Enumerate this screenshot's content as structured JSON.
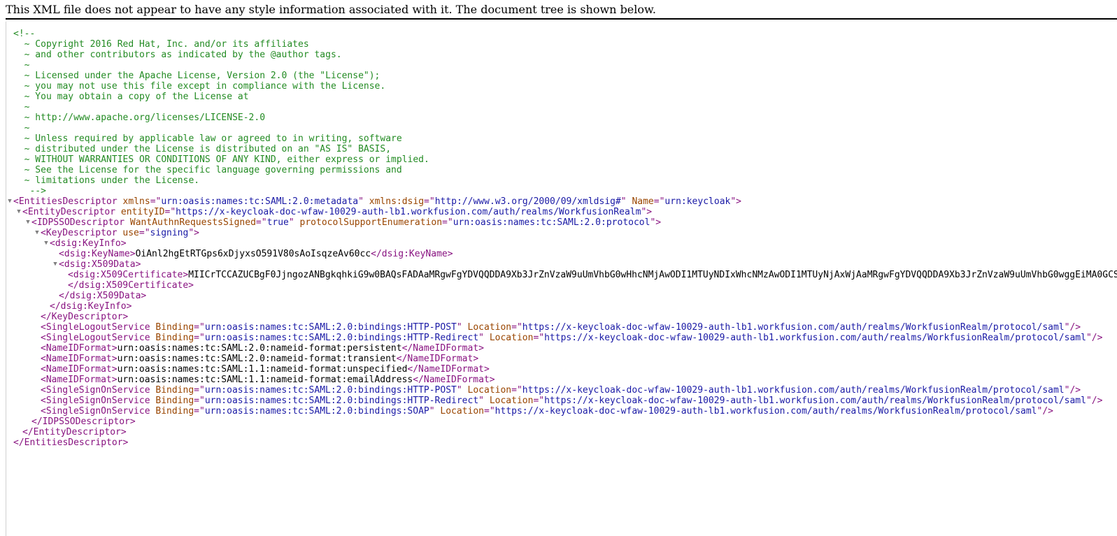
{
  "banner": {
    "text": "This XML file does not appear to have any style information associated with it. The document tree is shown below."
  },
  "colors": {
    "tag": "#881280",
    "attribute_name": "#994500",
    "attribute_value": "#1a1aa6",
    "comment": "#238b23",
    "text": "#000000"
  },
  "icons": {
    "expanded": "triangle-down-icon"
  },
  "comment_lines": [
    "<!--",
    "  ~ Copyright 2016 Red Hat, Inc. and/or its affiliates",
    "  ~ and other contributors as indicated by the @author tags.",
    "  ~",
    "  ~ Licensed under the Apache License, Version 2.0 (the \"License\");",
    "  ~ you may not use this file except in compliance with the License.",
    "  ~ You may obtain a copy of the License at",
    "  ~",
    "  ~ http://www.apache.org/licenses/LICENSE-2.0",
    "  ~",
    "  ~ Unless required by applicable law or agreed to in writing, software",
    "  ~ distributed under the License is distributed on an \"AS IS\" BASIS,",
    "  ~ WITHOUT WARRANTIES OR CONDITIONS OF ANY KIND, either express or implied.",
    "  ~ See the License for the specific language governing permissions and",
    "  ~ limitations under the License.",
    "   -->"
  ],
  "tree": [
    {
      "name": "entities-descriptor-open",
      "depth": 0,
      "fold": true,
      "parts": [
        [
          "t",
          "<EntitiesDescriptor"
        ],
        [
          "a",
          " xmlns"
        ],
        [
          "t",
          "=\""
        ],
        [
          "v",
          "urn:oasis:names:tc:SAML:2.0:metadata"
        ],
        [
          "t",
          "\""
        ],
        [
          "a",
          " xmlns:dsig"
        ],
        [
          "t",
          "=\""
        ],
        [
          "v",
          "http://www.w3.org/2000/09/xmldsig#"
        ],
        [
          "t",
          "\""
        ],
        [
          "a",
          " Name"
        ],
        [
          "t",
          "=\""
        ],
        [
          "v",
          "urn:keycloak"
        ],
        [
          "t",
          "\">"
        ]
      ]
    },
    {
      "name": "entity-descriptor-open",
      "depth": 1,
      "fold": true,
      "parts": [
        [
          "t",
          "<EntityDescriptor"
        ],
        [
          "a",
          " entityID"
        ],
        [
          "t",
          "=\""
        ],
        [
          "v",
          "https://x-keycloak-doc-wfaw-10029-auth-lb1.workfusion.com/auth/realms/WorkfusionRealm"
        ],
        [
          "t",
          "\">"
        ]
      ]
    },
    {
      "name": "idpsso-descriptor-open",
      "depth": 2,
      "fold": true,
      "parts": [
        [
          "t",
          "<IDPSSODescriptor"
        ],
        [
          "a",
          " WantAuthnRequestsSigned"
        ],
        [
          "t",
          "=\""
        ],
        [
          "v",
          "true"
        ],
        [
          "t",
          "\""
        ],
        [
          "a",
          " protocolSupportEnumeration"
        ],
        [
          "t",
          "=\""
        ],
        [
          "v",
          "urn:oasis:names:tc:SAML:2.0:protocol"
        ],
        [
          "t",
          "\">"
        ]
      ]
    },
    {
      "name": "key-descriptor-open",
      "depth": 3,
      "fold": true,
      "parts": [
        [
          "t",
          "<KeyDescriptor"
        ],
        [
          "a",
          " use"
        ],
        [
          "t",
          "=\""
        ],
        [
          "v",
          "signing"
        ],
        [
          "t",
          "\">"
        ]
      ]
    },
    {
      "name": "key-info-open",
      "depth": 4,
      "fold": true,
      "parts": [
        [
          "t",
          "<dsig:KeyInfo>"
        ]
      ]
    },
    {
      "name": "key-name",
      "depth": 5,
      "fold": false,
      "parts": [
        [
          "t",
          "<dsig:KeyName>"
        ],
        [
          "x",
          "OiAnl2hgEtRTGps6xDjyxsO591V80sAoIsqzeAv60cc"
        ],
        [
          "t",
          "</dsig:KeyName>"
        ]
      ]
    },
    {
      "name": "x509-data-open",
      "depth": 5,
      "fold": true,
      "parts": [
        [
          "t",
          "<dsig:X509Data>"
        ]
      ]
    },
    {
      "name": "x509-certificate",
      "depth": 6,
      "fold": false,
      "parts": [
        [
          "t",
          "<dsig:X509Certificate>"
        ],
        [
          "x",
          "MIICrTCCAZUCBgF0JjngozANBgkqhkiG9w0BAQsFADAaMRgwFgYDVQQDDA9Xb3JrZnVzaW9uUmVhbG0wHhcNMjAwODI1MTUyNDIxWhcNMzAwODI1MTUyNjAxWjAaMRgwFgYDVQQDDA9Xb3JrZnVzaW9uUmVhbG0wggEiMA0GCS"
        ]
      ]
    },
    {
      "name": "x509-certificate-close",
      "depth": 6,
      "fold": false,
      "parts": [
        [
          "t",
          "</dsig:X509Certificate>"
        ]
      ]
    },
    {
      "name": "x509-data-close",
      "depth": 5,
      "fold": false,
      "parts": [
        [
          "t",
          "</dsig:X509Data>"
        ]
      ]
    },
    {
      "name": "key-info-close",
      "depth": 4,
      "fold": false,
      "parts": [
        [
          "t",
          "</dsig:KeyInfo>"
        ]
      ]
    },
    {
      "name": "key-descriptor-close",
      "depth": 3,
      "fold": false,
      "parts": [
        [
          "t",
          "</KeyDescriptor>"
        ]
      ]
    },
    {
      "name": "single-logout-service-post",
      "depth": 3,
      "fold": false,
      "parts": [
        [
          "t",
          "<SingleLogoutService"
        ],
        [
          "a",
          " Binding"
        ],
        [
          "t",
          "=\""
        ],
        [
          "v",
          "urn:oasis:names:tc:SAML:2.0:bindings:HTTP-POST"
        ],
        [
          "t",
          "\""
        ],
        [
          "a",
          " Location"
        ],
        [
          "t",
          "=\""
        ],
        [
          "v",
          "https://x-keycloak-doc-wfaw-10029-auth-lb1.workfusion.com/auth/realms/WorkfusionRealm/protocol/saml"
        ],
        [
          "t",
          "\"/>"
        ]
      ]
    },
    {
      "name": "single-logout-service-redirect",
      "depth": 3,
      "fold": false,
      "parts": [
        [
          "t",
          "<SingleLogoutService"
        ],
        [
          "a",
          " Binding"
        ],
        [
          "t",
          "=\""
        ],
        [
          "v",
          "urn:oasis:names:tc:SAML:2.0:bindings:HTTP-Redirect"
        ],
        [
          "t",
          "\""
        ],
        [
          "a",
          " Location"
        ],
        [
          "t",
          "=\""
        ],
        [
          "v",
          "https://x-keycloak-doc-wfaw-10029-auth-lb1.workfusion.com/auth/realms/WorkfusionRealm/protocol/saml"
        ],
        [
          "t",
          "\"/>"
        ]
      ]
    },
    {
      "name": "nameid-format-persistent",
      "depth": 3,
      "fold": false,
      "parts": [
        [
          "t",
          "<NameIDFormat>"
        ],
        [
          "x",
          "urn:oasis:names:tc:SAML:2.0:nameid-format:persistent"
        ],
        [
          "t",
          "</NameIDFormat>"
        ]
      ]
    },
    {
      "name": "nameid-format-transient",
      "depth": 3,
      "fold": false,
      "parts": [
        [
          "t",
          "<NameIDFormat>"
        ],
        [
          "x",
          "urn:oasis:names:tc:SAML:2.0:nameid-format:transient"
        ],
        [
          "t",
          "</NameIDFormat>"
        ]
      ]
    },
    {
      "name": "nameid-format-unspecified",
      "depth": 3,
      "fold": false,
      "parts": [
        [
          "t",
          "<NameIDFormat>"
        ],
        [
          "x",
          "urn:oasis:names:tc:SAML:1.1:nameid-format:unspecified"
        ],
        [
          "t",
          "</NameIDFormat>"
        ]
      ]
    },
    {
      "name": "nameid-format-email",
      "depth": 3,
      "fold": false,
      "parts": [
        [
          "t",
          "<NameIDFormat>"
        ],
        [
          "x",
          "urn:oasis:names:tc:SAML:1.1:nameid-format:emailAddress"
        ],
        [
          "t",
          "</NameIDFormat>"
        ]
      ]
    },
    {
      "name": "single-sign-on-service-post",
      "depth": 3,
      "fold": false,
      "parts": [
        [
          "t",
          "<SingleSignOnService"
        ],
        [
          "a",
          " Binding"
        ],
        [
          "t",
          "=\""
        ],
        [
          "v",
          "urn:oasis:names:tc:SAML:2.0:bindings:HTTP-POST"
        ],
        [
          "t",
          "\""
        ],
        [
          "a",
          " Location"
        ],
        [
          "t",
          "=\""
        ],
        [
          "v",
          "https://x-keycloak-doc-wfaw-10029-auth-lb1.workfusion.com/auth/realms/WorkfusionRealm/protocol/saml"
        ],
        [
          "t",
          "\"/>"
        ]
      ]
    },
    {
      "name": "single-sign-on-service-redirect",
      "depth": 3,
      "fold": false,
      "parts": [
        [
          "t",
          "<SingleSignOnService"
        ],
        [
          "a",
          " Binding"
        ],
        [
          "t",
          "=\""
        ],
        [
          "v",
          "urn:oasis:names:tc:SAML:2.0:bindings:HTTP-Redirect"
        ],
        [
          "t",
          "\""
        ],
        [
          "a",
          " Location"
        ],
        [
          "t",
          "=\""
        ],
        [
          "v",
          "https://x-keycloak-doc-wfaw-10029-auth-lb1.workfusion.com/auth/realms/WorkfusionRealm/protocol/saml"
        ],
        [
          "t",
          "\"/>"
        ]
      ]
    },
    {
      "name": "single-sign-on-service-soap",
      "depth": 3,
      "fold": false,
      "parts": [
        [
          "t",
          "<SingleSignOnService"
        ],
        [
          "a",
          " Binding"
        ],
        [
          "t",
          "=\""
        ],
        [
          "v",
          "urn:oasis:names:tc:SAML:2.0:bindings:SOAP"
        ],
        [
          "t",
          "\""
        ],
        [
          "a",
          " Location"
        ],
        [
          "t",
          "=\""
        ],
        [
          "v",
          "https://x-keycloak-doc-wfaw-10029-auth-lb1.workfusion.com/auth/realms/WorkfusionRealm/protocol/saml"
        ],
        [
          "t",
          "\"/>"
        ]
      ]
    },
    {
      "name": "idpsso-descriptor-close",
      "depth": 2,
      "fold": false,
      "parts": [
        [
          "t",
          "</IDPSSODescriptor>"
        ]
      ]
    },
    {
      "name": "entity-descriptor-close",
      "depth": 1,
      "fold": false,
      "parts": [
        [
          "t",
          "</EntityDescriptor>"
        ]
      ]
    },
    {
      "name": "entities-descriptor-close",
      "depth": 0,
      "fold": false,
      "parts": [
        [
          "t",
          "</EntitiesDescriptor>"
        ]
      ]
    }
  ]
}
